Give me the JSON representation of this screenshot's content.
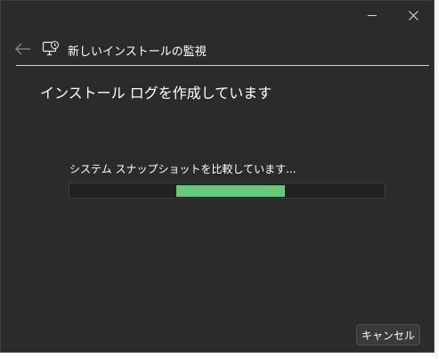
{
  "window": {
    "controls": {
      "minimize_icon": "minimize-icon",
      "close_icon": "close-icon"
    }
  },
  "nav": {
    "back_icon": "arrow-left-icon",
    "app_icon": "monitor-clock-icon",
    "title": "新しいインストールの監視"
  },
  "main": {
    "heading": "インストール ログを作成しています",
    "status": "システム スナップショットを比較しています...",
    "progress": {
      "indeterminate": true,
      "segment_start": 0.34,
      "segment_end": 0.685,
      "color": "#6cc67d"
    }
  },
  "footer": {
    "cancel_label": "キャンセル"
  },
  "colors": {
    "background": "#2b2b2b",
    "accent": "#6cc67d"
  }
}
